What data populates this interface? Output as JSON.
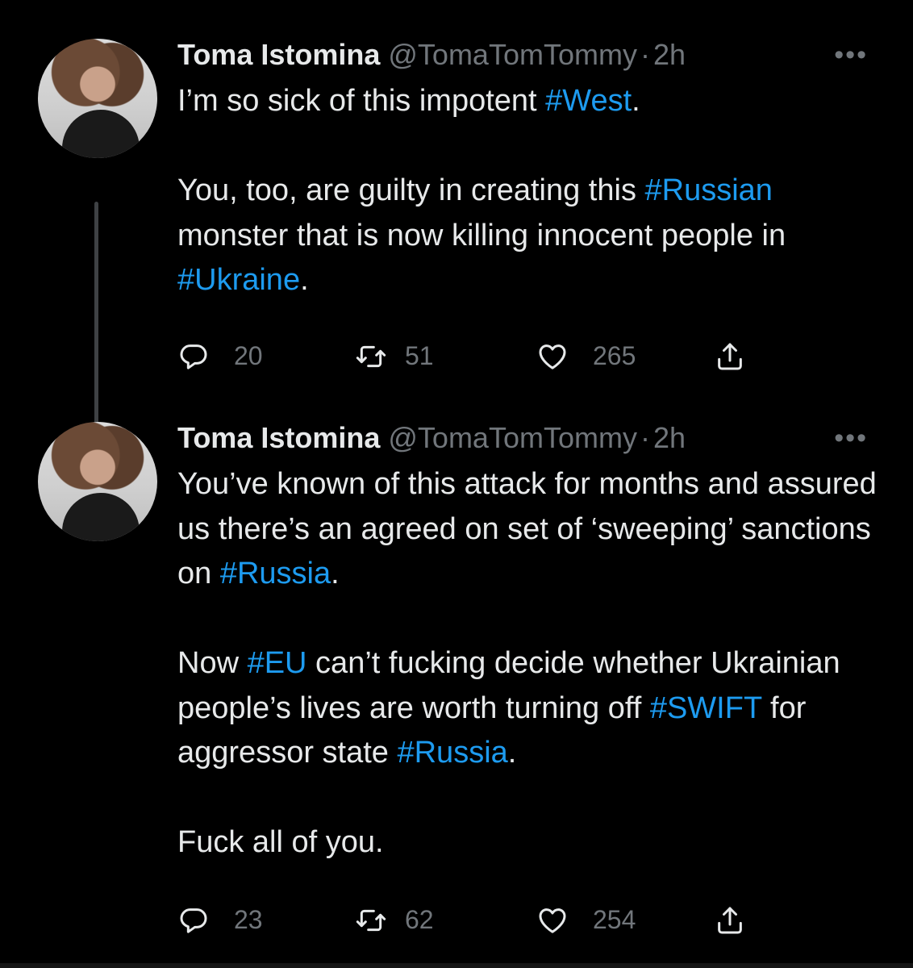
{
  "tweets": [
    {
      "author_name": "Toma Istomina",
      "handle": "@TomaTomTommy",
      "separator": "·",
      "time": "2h",
      "more": "•••",
      "paragraphs": [
        [
          {
            "t": "I’m so sick of this impotent "
          },
          {
            "t": "#West",
            "tag": true
          },
          {
            "t": "."
          }
        ],
        [
          {
            "t": "You, too, are guilty in creating this "
          },
          {
            "t": "#Russian",
            "tag": true
          },
          {
            "t": " monster that is now killing innocent people in "
          },
          {
            "t": "#Ukraine",
            "tag": true
          },
          {
            "t": "."
          }
        ]
      ],
      "replies": "20",
      "retweets": "51",
      "likes": "265"
    },
    {
      "author_name": "Toma Istomina",
      "handle": "@TomaTomTommy",
      "separator": "·",
      "time": "2h",
      "more": "•••",
      "paragraphs": [
        [
          {
            "t": "You’ve known of this attack for months and assured us there’s an agreed on set of ‘sweeping’ sanctions on "
          },
          {
            "t": "#Russia",
            "tag": true
          },
          {
            "t": "."
          }
        ],
        [
          {
            "t": "Now "
          },
          {
            "t": "#EU",
            "tag": true
          },
          {
            "t": " can’t fucking decide whether Ukrainian people’s lives are worth turning off "
          },
          {
            "t": "#SWIFT",
            "tag": true
          },
          {
            "t": " for aggressor state "
          },
          {
            "t": "#Russia",
            "tag": true
          },
          {
            "t": "."
          }
        ],
        [
          {
            "t": "Fuck all of you."
          }
        ]
      ],
      "replies": "23",
      "retweets": "62",
      "likes": "254"
    }
  ],
  "colors": {
    "background": "#000000",
    "text": "#e7e9ea",
    "muted": "#71767b",
    "hashtag": "#1d9bf0"
  },
  "icons": {
    "reply": "reply-icon",
    "retweet": "retweet-icon",
    "like": "heart-icon",
    "share": "share-icon",
    "more": "more-icon"
  }
}
